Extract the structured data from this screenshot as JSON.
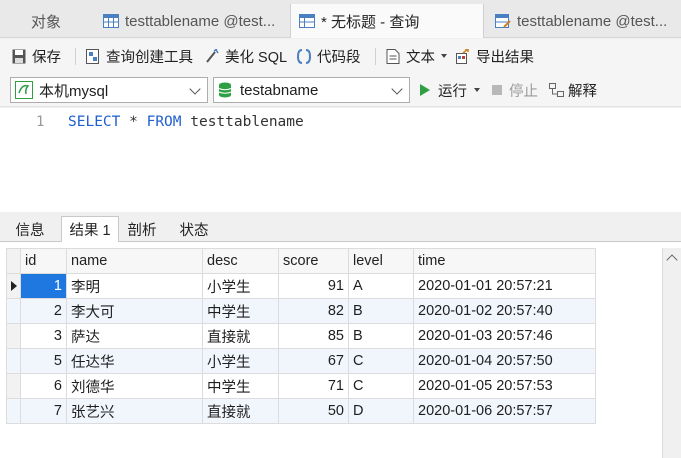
{
  "tabs": [
    {
      "label": "对象",
      "icon": "none"
    },
    {
      "label": "testtablename @test...",
      "icon": "table-icon"
    },
    {
      "label": "* 无标题 - 查询",
      "icon": "query-icon"
    },
    {
      "label": "testtablename @test...",
      "icon": "table-edit-icon"
    }
  ],
  "toolbar": {
    "save": "保存",
    "query_builder": "查询创建工具",
    "beautify": "美化 SQL",
    "snippet": "代码段",
    "text": "文本",
    "export": "导出结果"
  },
  "selectors": {
    "connection": "本机mysql",
    "database": "testabname",
    "run": "运行",
    "stop": "停止",
    "explain": "解释"
  },
  "editor": {
    "line_number": "1",
    "kw1": "SELECT",
    "rest1": " * ",
    "kw2": "FROM",
    "rest2": " testtablename"
  },
  "result_tabs": [
    "信息",
    "结果 1",
    "剖析",
    "状态"
  ],
  "grid": {
    "columns": [
      "id",
      "name",
      "desc",
      "score",
      "level",
      "time"
    ],
    "rows": [
      [
        "1",
        "李明",
        "小学生",
        "91",
        "A",
        "2020-01-01 20:57:21"
      ],
      [
        "2",
        "李大可",
        "中学生",
        "82",
        "B",
        "2020-01-02 20:57:40"
      ],
      [
        "3",
        "萨达",
        "直接就",
        "85",
        "B",
        "2020-01-03 20:57:46"
      ],
      [
        "5",
        "任达华",
        "小学生",
        "67",
        "C",
        "2020-01-04 20:57:50"
      ],
      [
        "6",
        "刘德华",
        "中学生",
        "71",
        "C",
        "2020-01-05 20:57:53"
      ],
      [
        "7",
        "张艺兴",
        "直接就",
        "50",
        "D",
        "2020-01-06 20:57:57"
      ]
    ]
  },
  "colors": {
    "accent": "#1f78e0",
    "keyword": "#1f5fd0",
    "run_green": "#2ea043",
    "alt_row": "#f1f6fd"
  }
}
